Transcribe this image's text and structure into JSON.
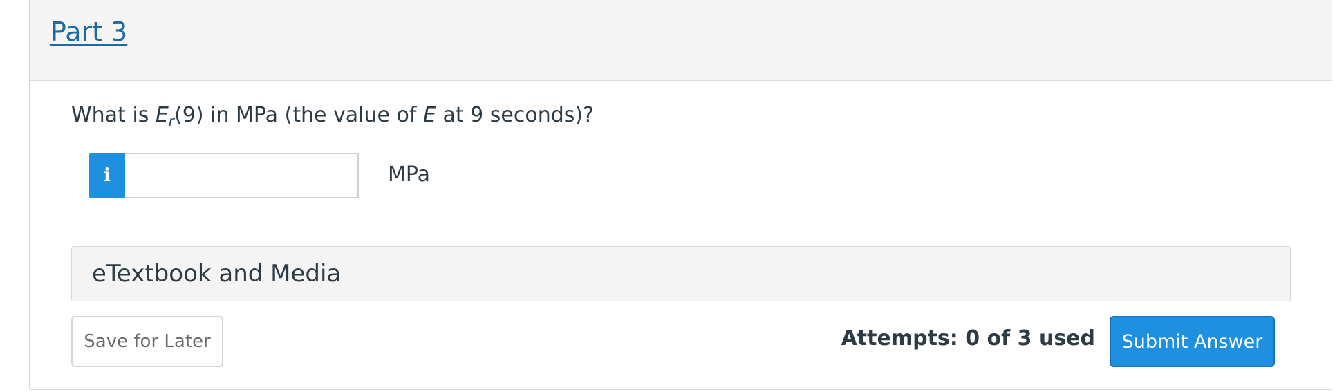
{
  "part": {
    "title": "Part 3"
  },
  "question": {
    "prefix": "What is ",
    "variable": "E",
    "subscript": "r",
    "middle": "(9) in MPa (the value of ",
    "italic_e": "E",
    "suffix": " at 9 seconds)?"
  },
  "answer": {
    "info_icon": "i",
    "value": "",
    "unit": "MPa"
  },
  "etextbook": {
    "label": "eTextbook and Media"
  },
  "footer": {
    "save_label": "Save for Later",
    "attempts_text": "Attempts: 0 of 3 used",
    "submit_label": "Submit Answer"
  },
  "colors": {
    "link": "#1b6ba5",
    "accent": "#1f8fe0",
    "text": "#2d3b45",
    "header_bg": "#f5f5f5"
  }
}
